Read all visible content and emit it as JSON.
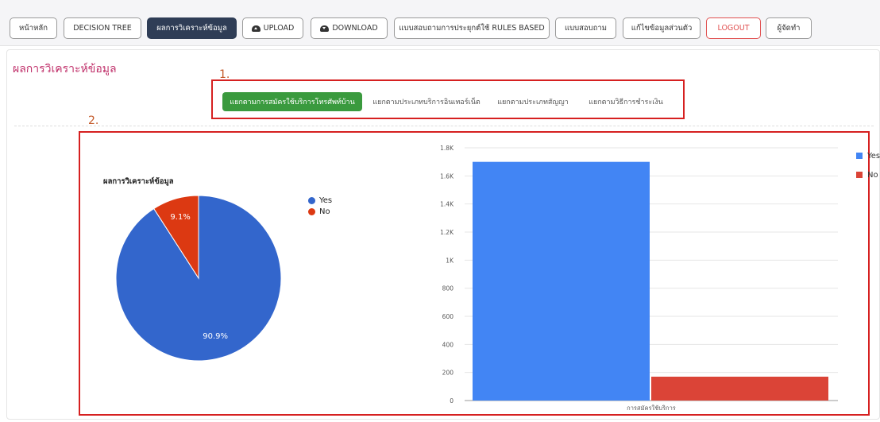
{
  "nav": {
    "items": [
      {
        "label": "หน้าหลัก"
      },
      {
        "label": "DECISION TREE"
      },
      {
        "label": "ผลการวิเคราะห์ข้อมูล"
      },
      {
        "label": "UPLOAD"
      },
      {
        "label": "DOWNLOAD"
      },
      {
        "label": "แบบสอบถามการประยุกต์ใช้ RULES BASED"
      },
      {
        "label": "แบบสอบถาม"
      },
      {
        "label": "แก้ไขข้อมูลส่วนตัว"
      },
      {
        "label": "LOGOUT"
      },
      {
        "label": "ผู้จัดทำ"
      }
    ],
    "active_index": 2
  },
  "page": {
    "title": "ผลการวิเคราะห์ข้อมูล"
  },
  "annotations": {
    "marker_1": "1.",
    "marker_2": "2."
  },
  "colors": {
    "accent_red": "#d62020",
    "tab_active": "#3a9a3e",
    "yes": "#3366cc",
    "no": "#dc3912",
    "bar_yes": "#4285f4",
    "bar_no": "#db4437"
  },
  "tabs": [
    {
      "label": "แยกตามการสมัครใช้บริการโทรศัพท์บ้าน"
    },
    {
      "label": "แยกตามประเภทบริการอินเทอร์เน็ต"
    },
    {
      "label": "แยกตามประเภทสัญญา"
    },
    {
      "label": "แยกตามวิธีการชำระเงิน"
    }
  ],
  "chart_data": [
    {
      "type": "pie",
      "title": "ผลการวิเคราะห์ข้อมูล",
      "slices": [
        {
          "name": "Yes",
          "value": 90.9,
          "label": "90.9%"
        },
        {
          "name": "No",
          "value": 9.1,
          "label": "9.1%"
        }
      ],
      "legend_position": "right"
    },
    {
      "type": "bar",
      "categories": [
        "การสมัครใช้บริการ"
      ],
      "series": [
        {
          "name": "Yes",
          "values": [
            1700
          ]
        },
        {
          "name": "No",
          "values": [
            170
          ]
        }
      ],
      "ylim": [
        0,
        1800
      ],
      "yticks": [
        "0",
        "200",
        "400",
        "600",
        "800",
        "1K",
        "1.2K",
        "1.4K",
        "1.6K",
        "1.8K"
      ],
      "grid": true,
      "legend_position": "right"
    }
  ]
}
